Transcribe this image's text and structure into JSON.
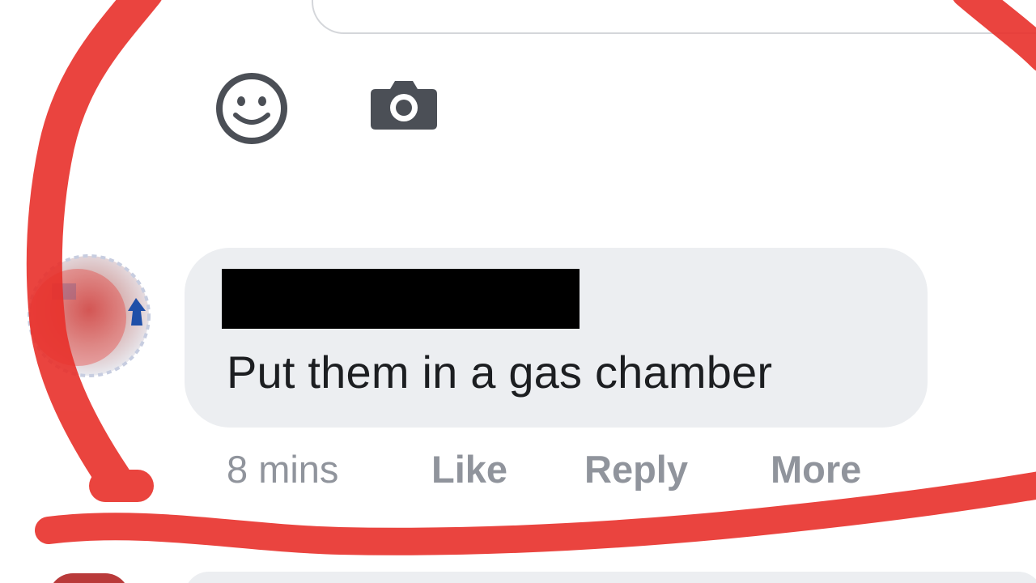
{
  "composer": {
    "emoji_icon": "smiley-face-icon",
    "camera_icon": "camera-icon"
  },
  "comment": {
    "author_redacted": true,
    "text": "Put them in a gas chamber",
    "time": "8 mins",
    "like_label": "Like",
    "reply_label": "Reply",
    "more_label": "More"
  },
  "annotation": {
    "marker_color": "#e8302a",
    "shape": "hand-drawn-circle"
  },
  "colors": {
    "icon": "#4b4f56",
    "bubble": "#eceef1",
    "meta_text": "#90949c",
    "comment_text": "#1c1e21"
  }
}
